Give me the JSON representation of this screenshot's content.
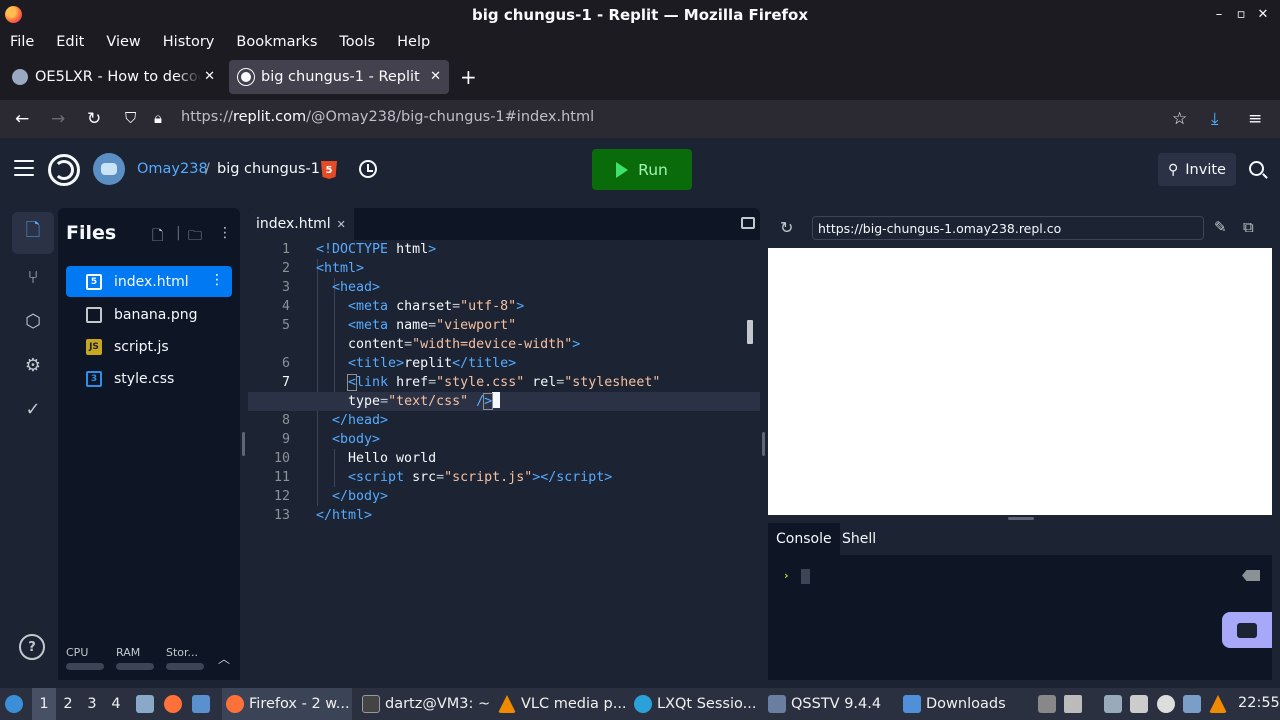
{
  "window": {
    "title": "big chungus-1 - Replit — Mozilla Firefox",
    "controls": [
      "–",
      "✕"
    ]
  },
  "menu": [
    "File",
    "Edit",
    "View",
    "History",
    "Bookmarks",
    "Tools",
    "Help"
  ],
  "tabs": [
    {
      "label": "OE5LXR - How to decode",
      "active": false
    },
    {
      "label": "big chungus-1 - Replit",
      "active": true
    }
  ],
  "address": {
    "prefix": "https://",
    "host": "replit.com",
    "path": "/@Omay238/big-chungus-1#index.html"
  },
  "replit": {
    "username": "Omay238",
    "separator": "/",
    "repl_name": "big chungus-1",
    "lang_badge": "5",
    "run_label": "Run",
    "invite_label": "Invite"
  },
  "files": {
    "title": "Files",
    "items": [
      {
        "name": "index.html",
        "icon": "html-file-icon",
        "selected": true
      },
      {
        "name": "banana.png",
        "icon": "image-file-icon",
        "selected": false
      },
      {
        "name": "script.js",
        "icon": "js-file-icon",
        "selected": false
      },
      {
        "name": "style.css",
        "icon": "css-file-icon",
        "selected": false
      }
    ],
    "meters": [
      "CPU",
      "RAM",
      "Stor..."
    ]
  },
  "editor": {
    "tab_label": "index.html",
    "lines": [
      "1",
      "2",
      "3",
      "4",
      "5",
      "",
      "6",
      "7",
      "",
      "8",
      "9",
      "10",
      "11",
      "12",
      "13"
    ]
  },
  "preview": {
    "url": "https://big-chungus-1.omay238.repl.co"
  },
  "console": {
    "tabs": [
      "Console",
      "Shell"
    ],
    "prompt": "›"
  },
  "taskbar": {
    "workspaces": [
      "1",
      "2",
      "3",
      "4"
    ],
    "apps": [
      {
        "label": "Firefox - 2 w...",
        "active": true
      },
      {
        "label": "dartz@VM3: ~",
        "active": false
      },
      {
        "label": "VLC media p...",
        "active": false
      },
      {
        "label": "LXQt Sessio...",
        "active": false
      },
      {
        "label": "QSSTV 9.4.4",
        "active": false
      },
      {
        "label": "Downloads",
        "active": false
      }
    ],
    "clock": "22:55"
  },
  "colors": {
    "run_green": "#0a6b0a",
    "selection_blue": "#0079f2",
    "editor_bg": "#1c2333",
    "tag_blue": "#57abff",
    "string_peach": "#f5c0a0"
  }
}
